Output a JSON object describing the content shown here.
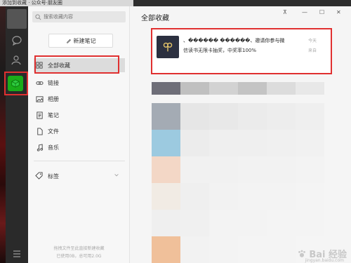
{
  "titlebar": {
    "text": "添加到收藏 · 公众号·朋友圈"
  },
  "rail": {
    "icons": [
      "chat-icon",
      "contacts-icon",
      "favorites-icon",
      "menu-icon"
    ]
  },
  "sidebar": {
    "search_placeholder": "搜索收藏内容",
    "new_note_label": "新建笔记",
    "items": [
      {
        "label": "全部收藏",
        "icon": "grid-icon"
      },
      {
        "label": "链接",
        "icon": "link-icon"
      },
      {
        "label": "相册",
        "icon": "image-icon"
      },
      {
        "label": "笔记",
        "icon": "note-icon"
      },
      {
        "label": "文件",
        "icon": "file-icon"
      },
      {
        "label": "音乐",
        "icon": "music-icon"
      }
    ],
    "tags_label": "标签",
    "footer_hint": "拖拽文件至此直接新建收藏",
    "footer_usage": "已使用0B，总可用2.0G"
  },
  "main": {
    "title": "全部收藏",
    "window_controls": [
      "pin-icon",
      "minimize-icon",
      "maximize-icon",
      "close-icon"
    ],
    "card": {
      "title": "、������ ������、邀请你参与微",
      "subtitle": "信读书无限卡抽奖，中奖率100%",
      "time": "今天",
      "source": "来自"
    }
  },
  "watermark": {
    "text": "Bai 经验",
    "sub": "jingyan.baidu.com"
  },
  "colors": {
    "accent_green": "#1aad19",
    "highlight_red": "#e03030"
  }
}
